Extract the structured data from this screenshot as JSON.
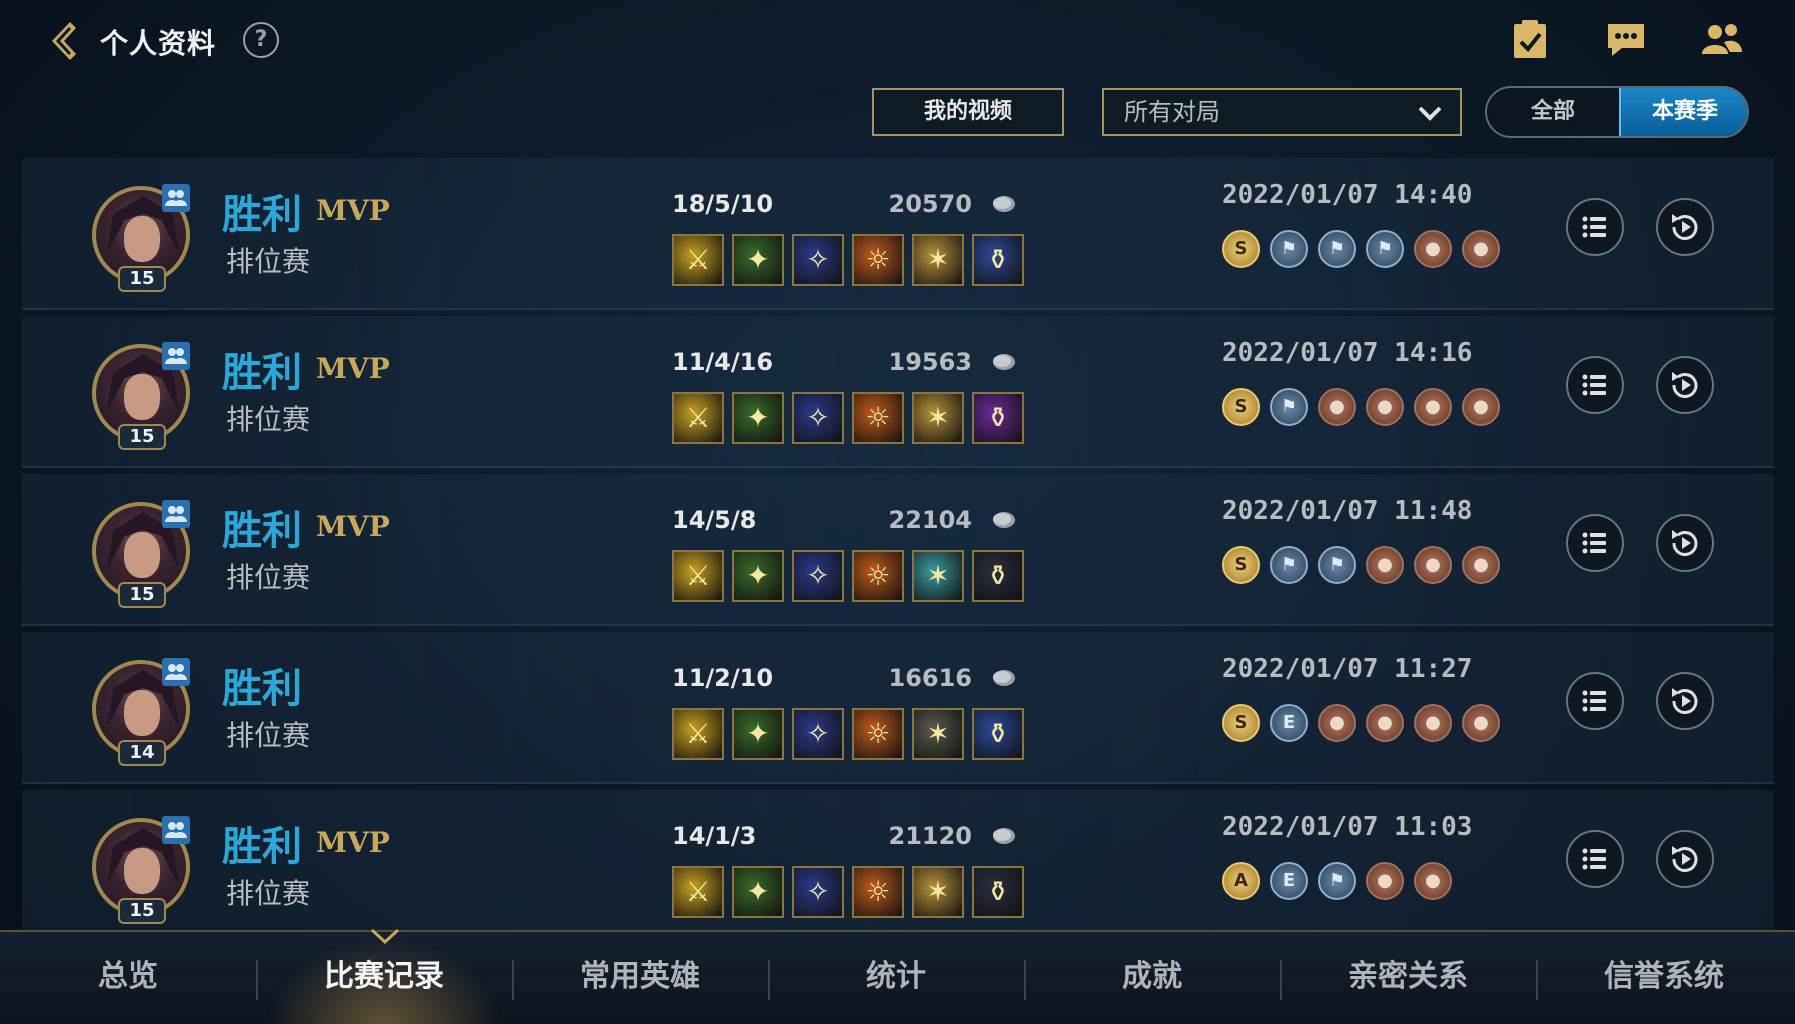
{
  "header": {
    "title": "个人资料",
    "help_label": "?"
  },
  "filters": {
    "my_videos": "我的视频",
    "match_type": "所有对局",
    "toggle_all": "全部",
    "toggle_season": "本赛季"
  },
  "matches": [
    {
      "level": "15",
      "result": "胜利",
      "mvp": "MVP",
      "mode": "排位赛",
      "kda": "18/5/10",
      "gold": "20570",
      "date": "2022/01/07 14:40",
      "items": [
        "#c8a020",
        "#3a6a2a",
        "#2a3a8a",
        "#c05a1a",
        "#b8903a",
        "#2a4a9a"
      ],
      "badges": [
        "S",
        "gold"
      ]
    },
    {
      "level": "15",
      "result": "胜利",
      "mvp": "MVP",
      "mode": "排位赛",
      "kda": "11/4/16",
      "gold": "19563",
      "date": "2022/01/07 14:16",
      "items": [
        "#c8a020",
        "#3a6a2a",
        "#2a3a8a",
        "#c05a1a",
        "#b8903a",
        "#6a2a9a"
      ]
    },
    {
      "level": "15",
      "result": "胜利",
      "mvp": "MVP",
      "mode": "排位赛",
      "kda": "14/5/8",
      "gold": "22104",
      "date": "2022/01/07 11:48",
      "items": [
        "#c8a020",
        "#3a6a2a",
        "#2a3a8a",
        "#c05a1a",
        "#3a9aa0",
        "#2a3040"
      ]
    },
    {
      "level": "14",
      "result": "胜利",
      "mvp": "",
      "mode": "排位赛",
      "kda": "11/2/10",
      "gold": "16616",
      "date": "2022/01/07 11:27",
      "items": [
        "#c8a020",
        "#3a6a2a",
        "#2a3a8a",
        "#c05a1a",
        "#5a5a50",
        "#2a4a9a"
      ]
    },
    {
      "level": "15",
      "result": "胜利",
      "mvp": "MVP",
      "mode": "排位赛",
      "kda": "14/1/3",
      "gold": "21120",
      "date": "2022/01/07 11:03",
      "items": [
        "#c8a020",
        "#3a6a2a",
        "#2a3a8a",
        "#c05a1a",
        "#b8903a",
        "#2a3040"
      ]
    }
  ],
  "badge_rows": [
    [
      "S",
      "b",
      "b",
      "b",
      "c",
      "c"
    ],
    [
      "S",
      "b",
      "c",
      "c",
      "c",
      "c"
    ],
    [
      "S",
      "b",
      "b",
      "c",
      "c",
      "c"
    ],
    [
      "S",
      "E",
      "c",
      "c",
      "c",
      "c"
    ],
    [
      "A",
      "E",
      "b",
      "c",
      "c"
    ]
  ],
  "tabs": [
    "总览",
    "比赛记录",
    "常用英雄",
    "统计",
    "成就",
    "亲密关系",
    "信誉系统"
  ],
  "active_tab": "比赛记录",
  "colors": {
    "accent_blue": "#2aa8d8",
    "gold_border": "#a8925a",
    "mvp_gold": "#c8a85a"
  }
}
